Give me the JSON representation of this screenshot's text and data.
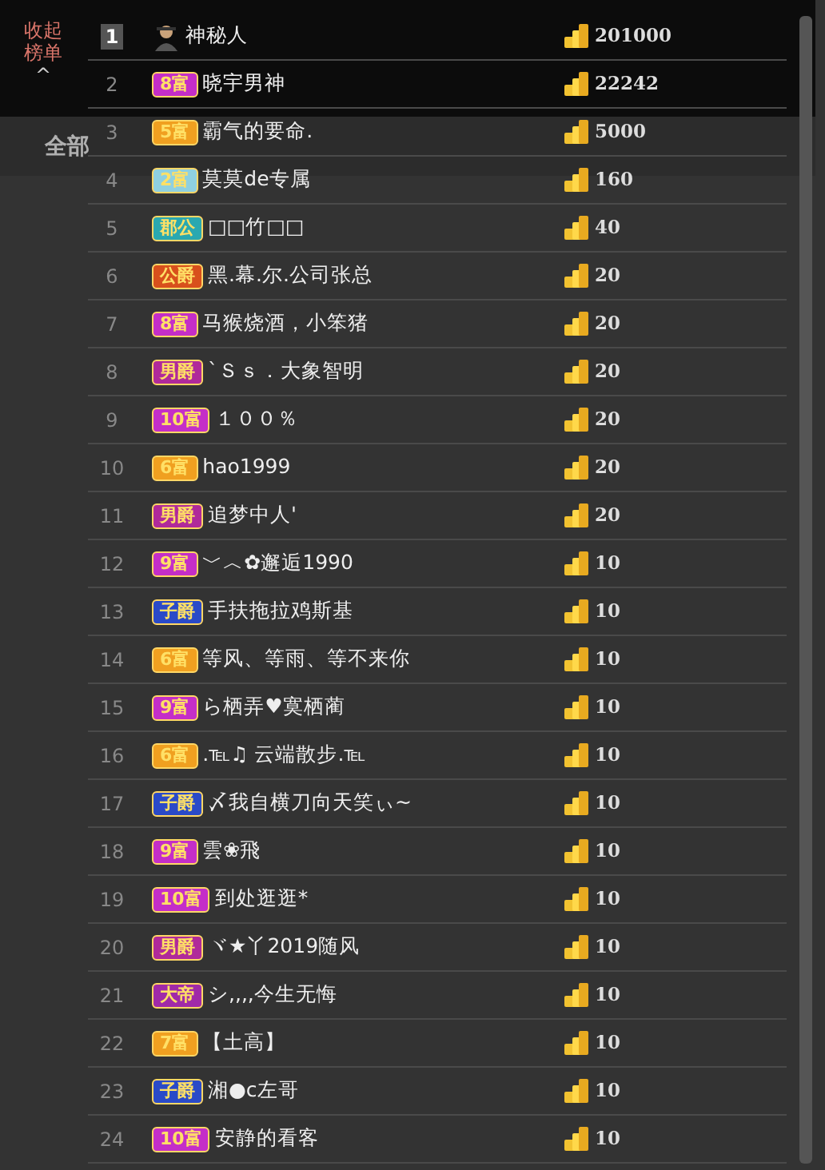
{
  "collapse_button": {
    "label": "收起榜单",
    "caret": "^"
  },
  "tabs": [
    {
      "label": "全部",
      "selected": true
    }
  ],
  "ranking": [
    {
      "rank": "1",
      "kind": "avatar",
      "name": "神秘人",
      "amount": "201000"
    },
    {
      "rank": "2",
      "kind": "badge",
      "badge": "8富",
      "color": "#c42ec8",
      "name": "晓宇男神",
      "amount": "22242"
    },
    {
      "rank": "3",
      "kind": "badge",
      "badge": "5富",
      "color": "#f0a020",
      "name": "霸气的要命.",
      "amount": "5000"
    },
    {
      "rank": "4",
      "kind": "badge",
      "badge": "2富",
      "color": "#8fd0e0",
      "name": "莫莫de专属",
      "amount": "160"
    },
    {
      "rank": "5",
      "kind": "badge",
      "badge": "郡公",
      "color": "#2aa8b0",
      "name": "□□竹□□",
      "amount": "40"
    },
    {
      "rank": "6",
      "kind": "badge",
      "badge": "公爵",
      "color": "#d8501c",
      "name": "黑.幕.尔.公司张总",
      "amount": "20"
    },
    {
      "rank": "7",
      "kind": "badge",
      "badge": "8富",
      "color": "#c42ec8",
      "name": "马猴烧酒，小笨猪",
      "amount": "20"
    },
    {
      "rank": "8",
      "kind": "badge",
      "badge": "男爵",
      "color": "#b02a9a",
      "name": "`Ｓｓ．大象智明",
      "amount": "20"
    },
    {
      "rank": "9",
      "kind": "badge",
      "badge": "10富",
      "color": "#c42ec8",
      "name": "１００％",
      "amount": "20"
    },
    {
      "rank": "10",
      "kind": "badge",
      "badge": "6富",
      "color": "#f0a020",
      "name": "hao1999",
      "amount": "20"
    },
    {
      "rank": "11",
      "kind": "badge",
      "badge": "男爵",
      "color": "#b02a9a",
      "name": "追梦中人'",
      "amount": "20"
    },
    {
      "rank": "12",
      "kind": "badge",
      "badge": "9富",
      "color": "#c42ec8",
      "name": "﹀︿✿邂逅1990",
      "amount": "10"
    },
    {
      "rank": "13",
      "kind": "badge",
      "badge": "子爵",
      "color": "#2a4ac8",
      "name": "手扶拖拉鸡斯基",
      "amount": "10"
    },
    {
      "rank": "14",
      "kind": "badge",
      "badge": "6富",
      "color": "#f0a020",
      "name": "等风、等雨、等不来你",
      "amount": "10"
    },
    {
      "rank": "15",
      "kind": "badge",
      "badge": "9富",
      "color": "#c42ec8",
      "name": "ら栖弄♥寞栖蔺",
      "amount": "10"
    },
    {
      "rank": "16",
      "kind": "badge",
      "badge": "6富",
      "color": "#f0a020",
      "name": ".℡♫ 云端散步.℡",
      "amount": "10"
    },
    {
      "rank": "17",
      "kind": "badge",
      "badge": "子爵",
      "color": "#2a4ac8",
      "name": "〆我自横刀向天笑ぃ~",
      "amount": "10"
    },
    {
      "rank": "18",
      "kind": "badge",
      "badge": "9富",
      "color": "#c42ec8",
      "name": "雲❀飛",
      "amount": "10"
    },
    {
      "rank": "19",
      "kind": "badge",
      "badge": "10富",
      "color": "#c42ec8",
      "name": "到处逛逛*",
      "amount": "10"
    },
    {
      "rank": "20",
      "kind": "badge",
      "badge": "男爵",
      "color": "#b02a9a",
      "name": "ヾ★丫2019随风",
      "amount": "10"
    },
    {
      "rank": "21",
      "kind": "badge",
      "badge": "大帝",
      "color": "#a02aa8",
      "name": "シ,,,,今生无悔",
      "amount": "10"
    },
    {
      "rank": "22",
      "kind": "badge",
      "badge": "7富",
      "color": "#f0a020",
      "name": "【土高】",
      "amount": "10"
    },
    {
      "rank": "23",
      "kind": "badge",
      "badge": "子爵",
      "color": "#2a4ac8",
      "name": "湘●c左哥",
      "amount": "10"
    },
    {
      "rank": "24",
      "kind": "badge",
      "badge": "10富",
      "color": "#c42ec8",
      "name": "安静的看客",
      "amount": "10"
    }
  ]
}
